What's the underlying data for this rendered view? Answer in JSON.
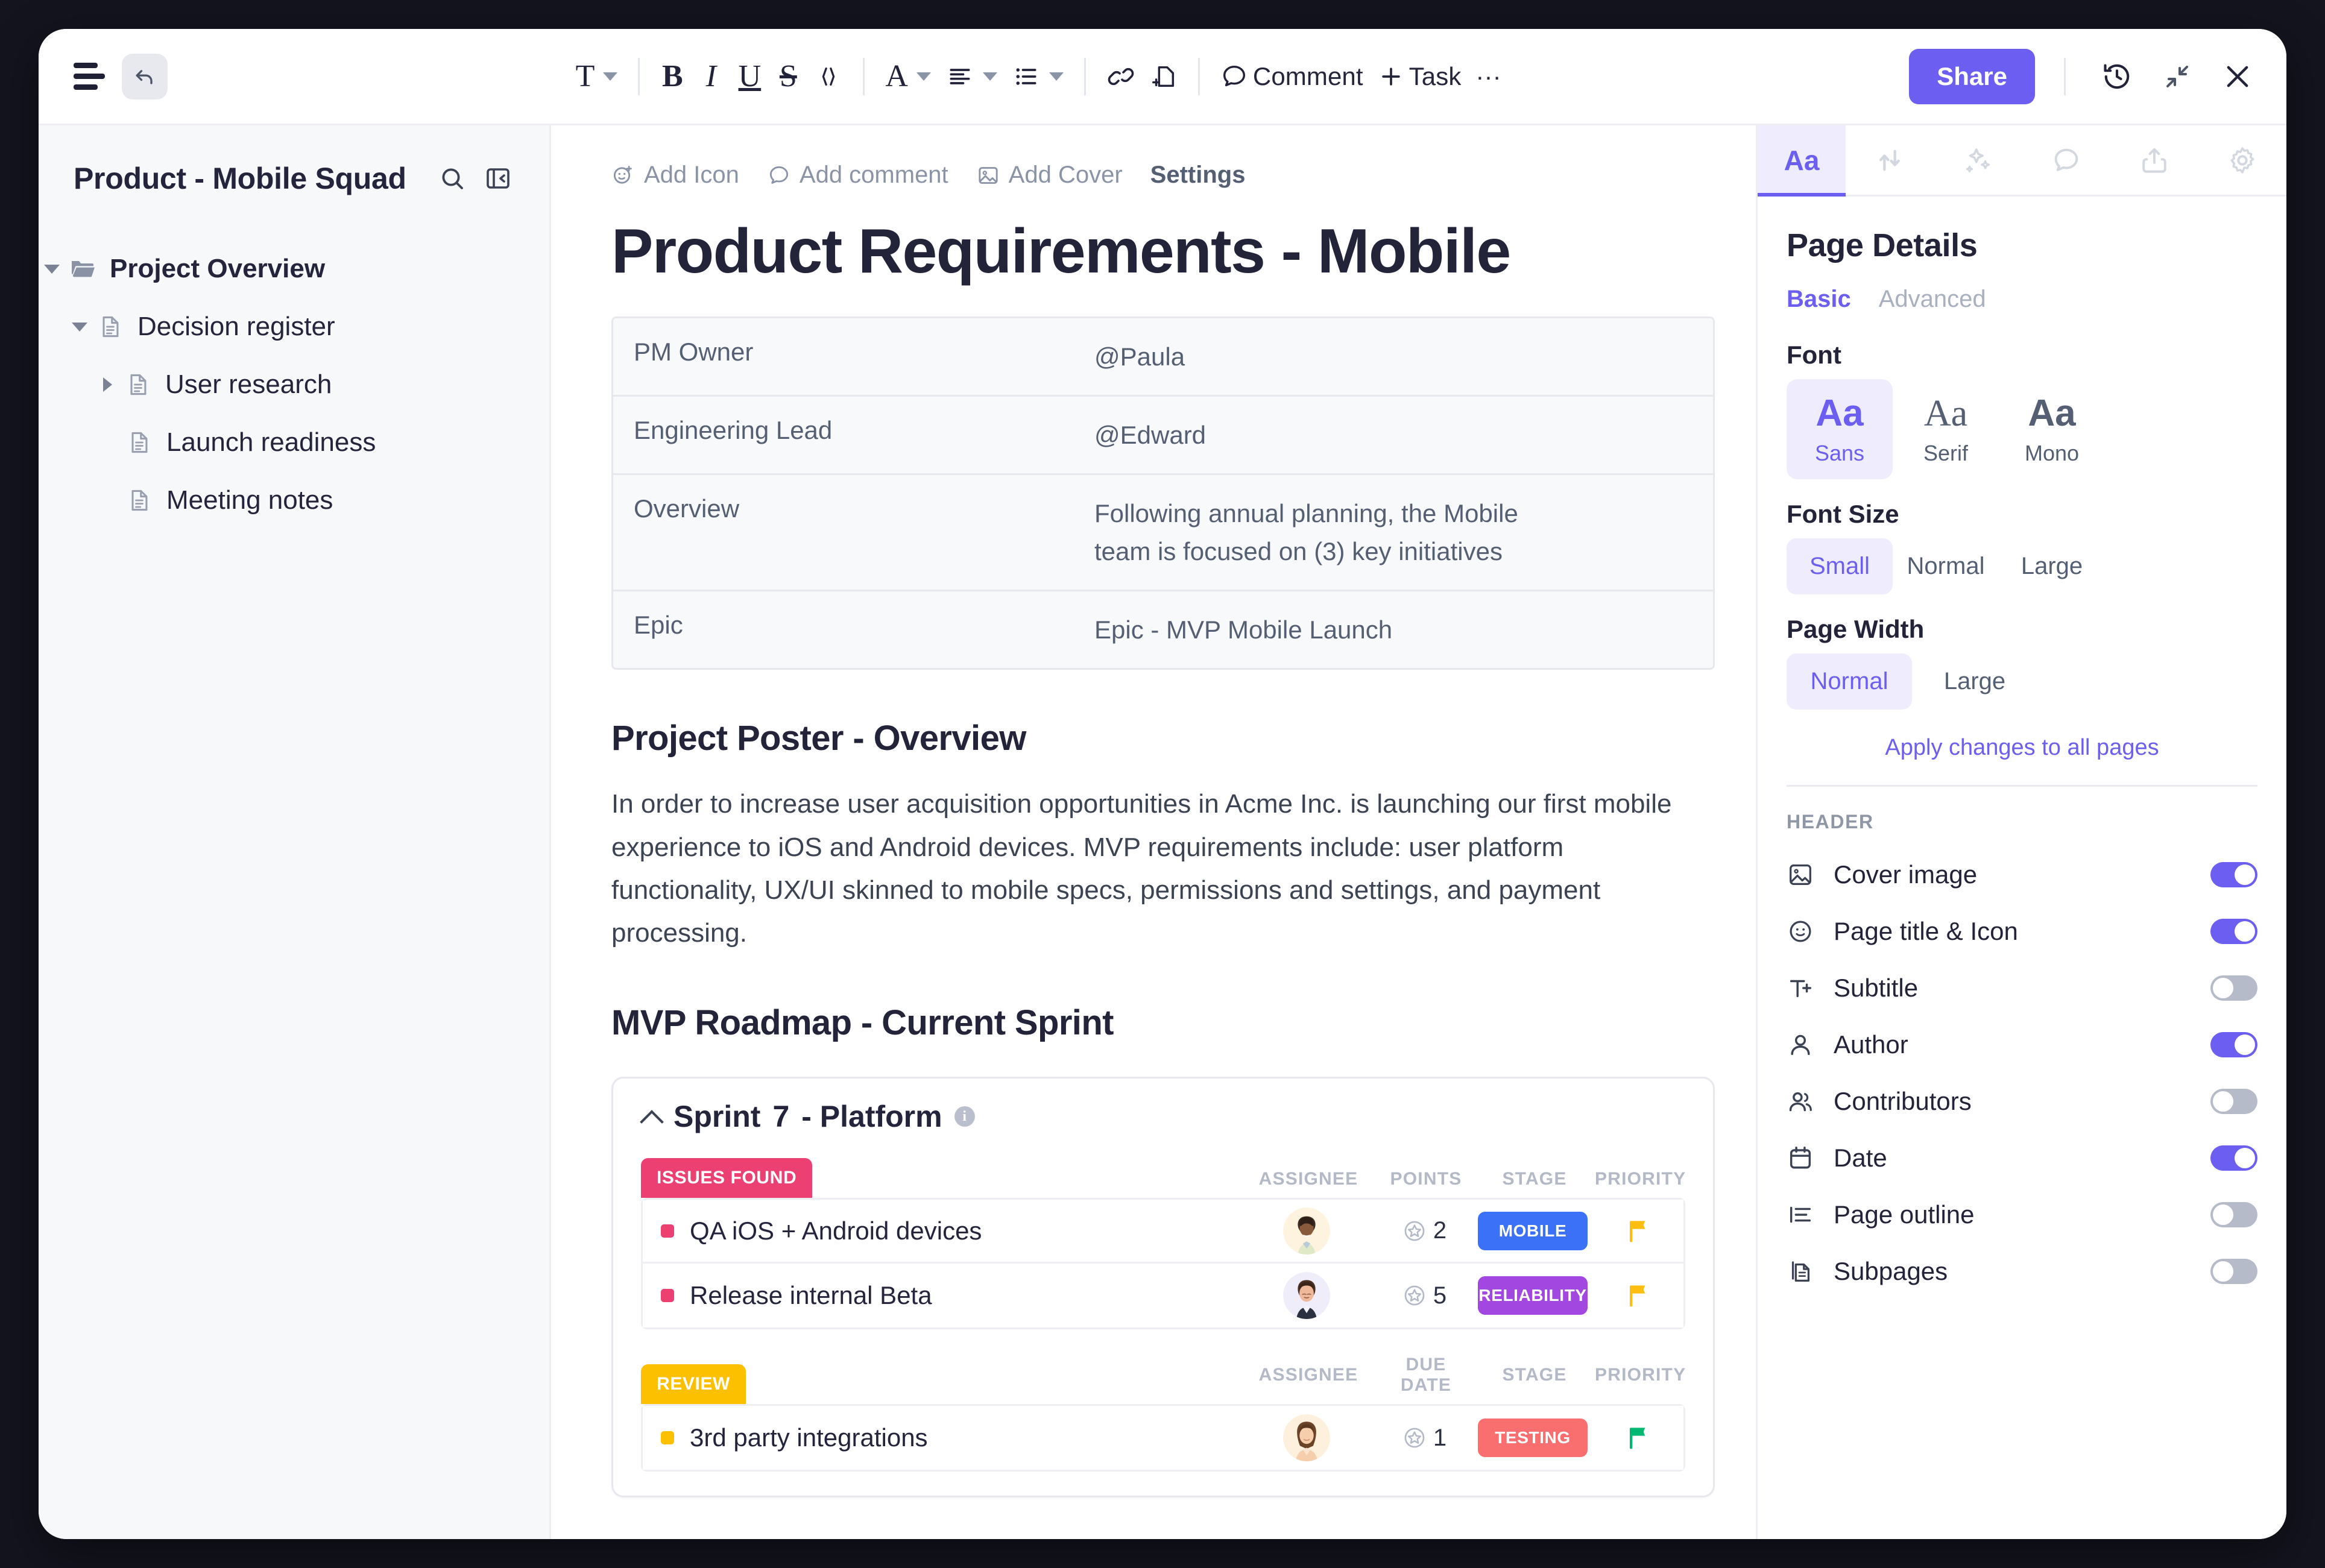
{
  "toolbar": {
    "menu_icon": "hamburger-menu-icon",
    "undo_icon": "undo-arrow-icon",
    "text_style_icon": "T",
    "bold_label": "B",
    "italic_label": "I",
    "underline_label": "U",
    "strikethrough_label": "S",
    "code_label": "</>",
    "font_color_label": "A",
    "align_icon": "align-left-icon",
    "list_icon": "bullet-list-icon",
    "link_icon": "link-icon",
    "page_icon": "insert-page-icon",
    "comment_label": "Comment",
    "task_label": "Task",
    "more_label": "···",
    "share_label": "Share",
    "history_icon": "history-clock-icon",
    "collapse_icon": "collapse-icon",
    "close_icon": "close-x-icon"
  },
  "sidebar": {
    "title": "Product - Mobile Squad",
    "search_icon": "search-icon",
    "panel_icon": "collapse-panel-icon",
    "items": [
      {
        "label": "Project Overview",
        "level": 0,
        "twisty": "down",
        "icon": "folder-icon",
        "bold": true
      },
      {
        "label": "Decision register",
        "level": 1,
        "twisty": "down",
        "icon": "document-icon",
        "bold": false
      },
      {
        "label": "User research",
        "level": 2,
        "twisty": "right",
        "icon": "document-icon",
        "bold": false
      },
      {
        "label": "Launch readiness",
        "level": 2,
        "twisty": "none",
        "icon": "document-icon",
        "bold": false
      },
      {
        "label": "Meeting notes",
        "level": 2,
        "twisty": "none",
        "icon": "document-icon",
        "bold": false
      }
    ]
  },
  "document": {
    "actions": [
      {
        "label": "Add Icon",
        "icon": "add-icon-smiley"
      },
      {
        "label": "Add comment",
        "icon": "comment-icon"
      },
      {
        "label": "Add Cover",
        "icon": "image-icon"
      },
      {
        "label": "Settings",
        "icon": "none"
      }
    ],
    "title": "Product Requirements - Mobile",
    "info_table": [
      {
        "key": "PM Owner",
        "value": "@Paula"
      },
      {
        "key": "Engineering Lead",
        "value": "@Edward"
      },
      {
        "key": "Overview",
        "value": "Following annual planning, the Mobile team is focused on (3) key initiatives"
      },
      {
        "key": "Epic",
        "value": "Epic - MVP Mobile Launch"
      }
    ],
    "section_poster_heading": "Project Poster - Overview",
    "section_poster_body": "In order to increase user acquisition opportunities in Acme Inc. is launching our first mobile experience to iOS and Android devices. MVP requirements include: user platform functionality, UX/UI skinned to mobile specs, permissions and settings, and payment processing.",
    "section_roadmap_heading": "MVP Roadmap - Current Sprint",
    "sprint": {
      "name": "Sprint",
      "number": "7",
      "suffix": "- Platform",
      "info_icon": "info-icon",
      "groups": [
        {
          "badge": "ISSUES FOUND",
          "badge_color": "#ec4073",
          "columns": [
            "ASSIGNEE",
            "POINTS",
            "STAGE",
            "PRIORITY"
          ],
          "tasks": [
            {
              "name": "QA iOS + Android devices",
              "dot_color": "#ec4073",
              "assignee": "avatar-male-1",
              "points": "2",
              "stage": "MOBILE",
              "stage_color": "#3b71f7",
              "priority_flag_color": "#fdbe10"
            },
            {
              "name": "Release internal Beta",
              "dot_color": "#ec4073",
              "assignee": "avatar-male-2",
              "points": "5",
              "stage": "RELIABILITY",
              "stage_color": "#a247e0",
              "priority_flag_color": "#fdbe10"
            }
          ]
        },
        {
          "badge": "REVIEW",
          "badge_color": "#fdc000",
          "columns": [
            "ASSIGNEE",
            "DUE DATE",
            "STAGE",
            "PRIORITY"
          ],
          "tasks": [
            {
              "name": "3rd party integrations",
              "dot_color": "#fdc000",
              "assignee": "avatar-female-1",
              "points": "1",
              "stage": "TESTING",
              "stage_color": "#f96e6e",
              "priority_flag_color": "#00b871"
            }
          ]
        }
      ]
    }
  },
  "right_panel": {
    "tabs": [
      {
        "icon": "font-aa-icon",
        "label": "Aa",
        "active": true
      },
      {
        "icon": "relationships-icon",
        "label": "",
        "active": false
      },
      {
        "icon": "ai-sparkle-icon",
        "label": "",
        "active": false
      },
      {
        "icon": "comment-icon",
        "label": "",
        "active": false
      },
      {
        "icon": "share-upload-icon",
        "label": "",
        "active": false
      },
      {
        "icon": "gear-icon",
        "label": "",
        "active": false
      }
    ],
    "title": "Page Details",
    "subtabs": [
      {
        "label": "Basic",
        "active": true
      },
      {
        "label": "Advanced",
        "active": false
      }
    ],
    "font_label": "Font",
    "font_options": [
      {
        "sample": "Aa",
        "label": "Sans",
        "active": true
      },
      {
        "sample": "Aa",
        "label": "Serif",
        "active": false
      },
      {
        "sample": "Aa",
        "label": "Mono",
        "active": false
      }
    ],
    "font_size_label": "Font Size",
    "font_size_options": [
      {
        "label": "Small",
        "active": true
      },
      {
        "label": "Normal",
        "active": false
      },
      {
        "label": "Large",
        "active": false
      }
    ],
    "page_width_label": "Page Width",
    "page_width_options": [
      {
        "label": "Normal",
        "active": true
      },
      {
        "label": "Large",
        "active": false
      }
    ],
    "apply_all_label": "Apply changes to all pages",
    "header_label": "HEADER",
    "header_toggles": [
      {
        "label": "Cover image",
        "icon": "image-icon",
        "on": true
      },
      {
        "label": "Page title & Icon",
        "icon": "smiley-icon",
        "on": true
      },
      {
        "label": "Subtitle",
        "icon": "subtitle-icon",
        "on": false
      },
      {
        "label": "Author",
        "icon": "person-icon",
        "on": true
      },
      {
        "label": "Contributors",
        "icon": "people-icon",
        "on": false
      },
      {
        "label": "Date",
        "icon": "calendar-icon",
        "on": true
      },
      {
        "label": "Page outline",
        "icon": "outline-icon",
        "on": false
      },
      {
        "label": "Subpages",
        "icon": "subpages-icon",
        "on": false
      }
    ]
  },
  "colors": {
    "accent": "#6b5ef0",
    "accent_soft": "#eeecfd",
    "text": "#23233a",
    "muted": "#8b93a7"
  }
}
